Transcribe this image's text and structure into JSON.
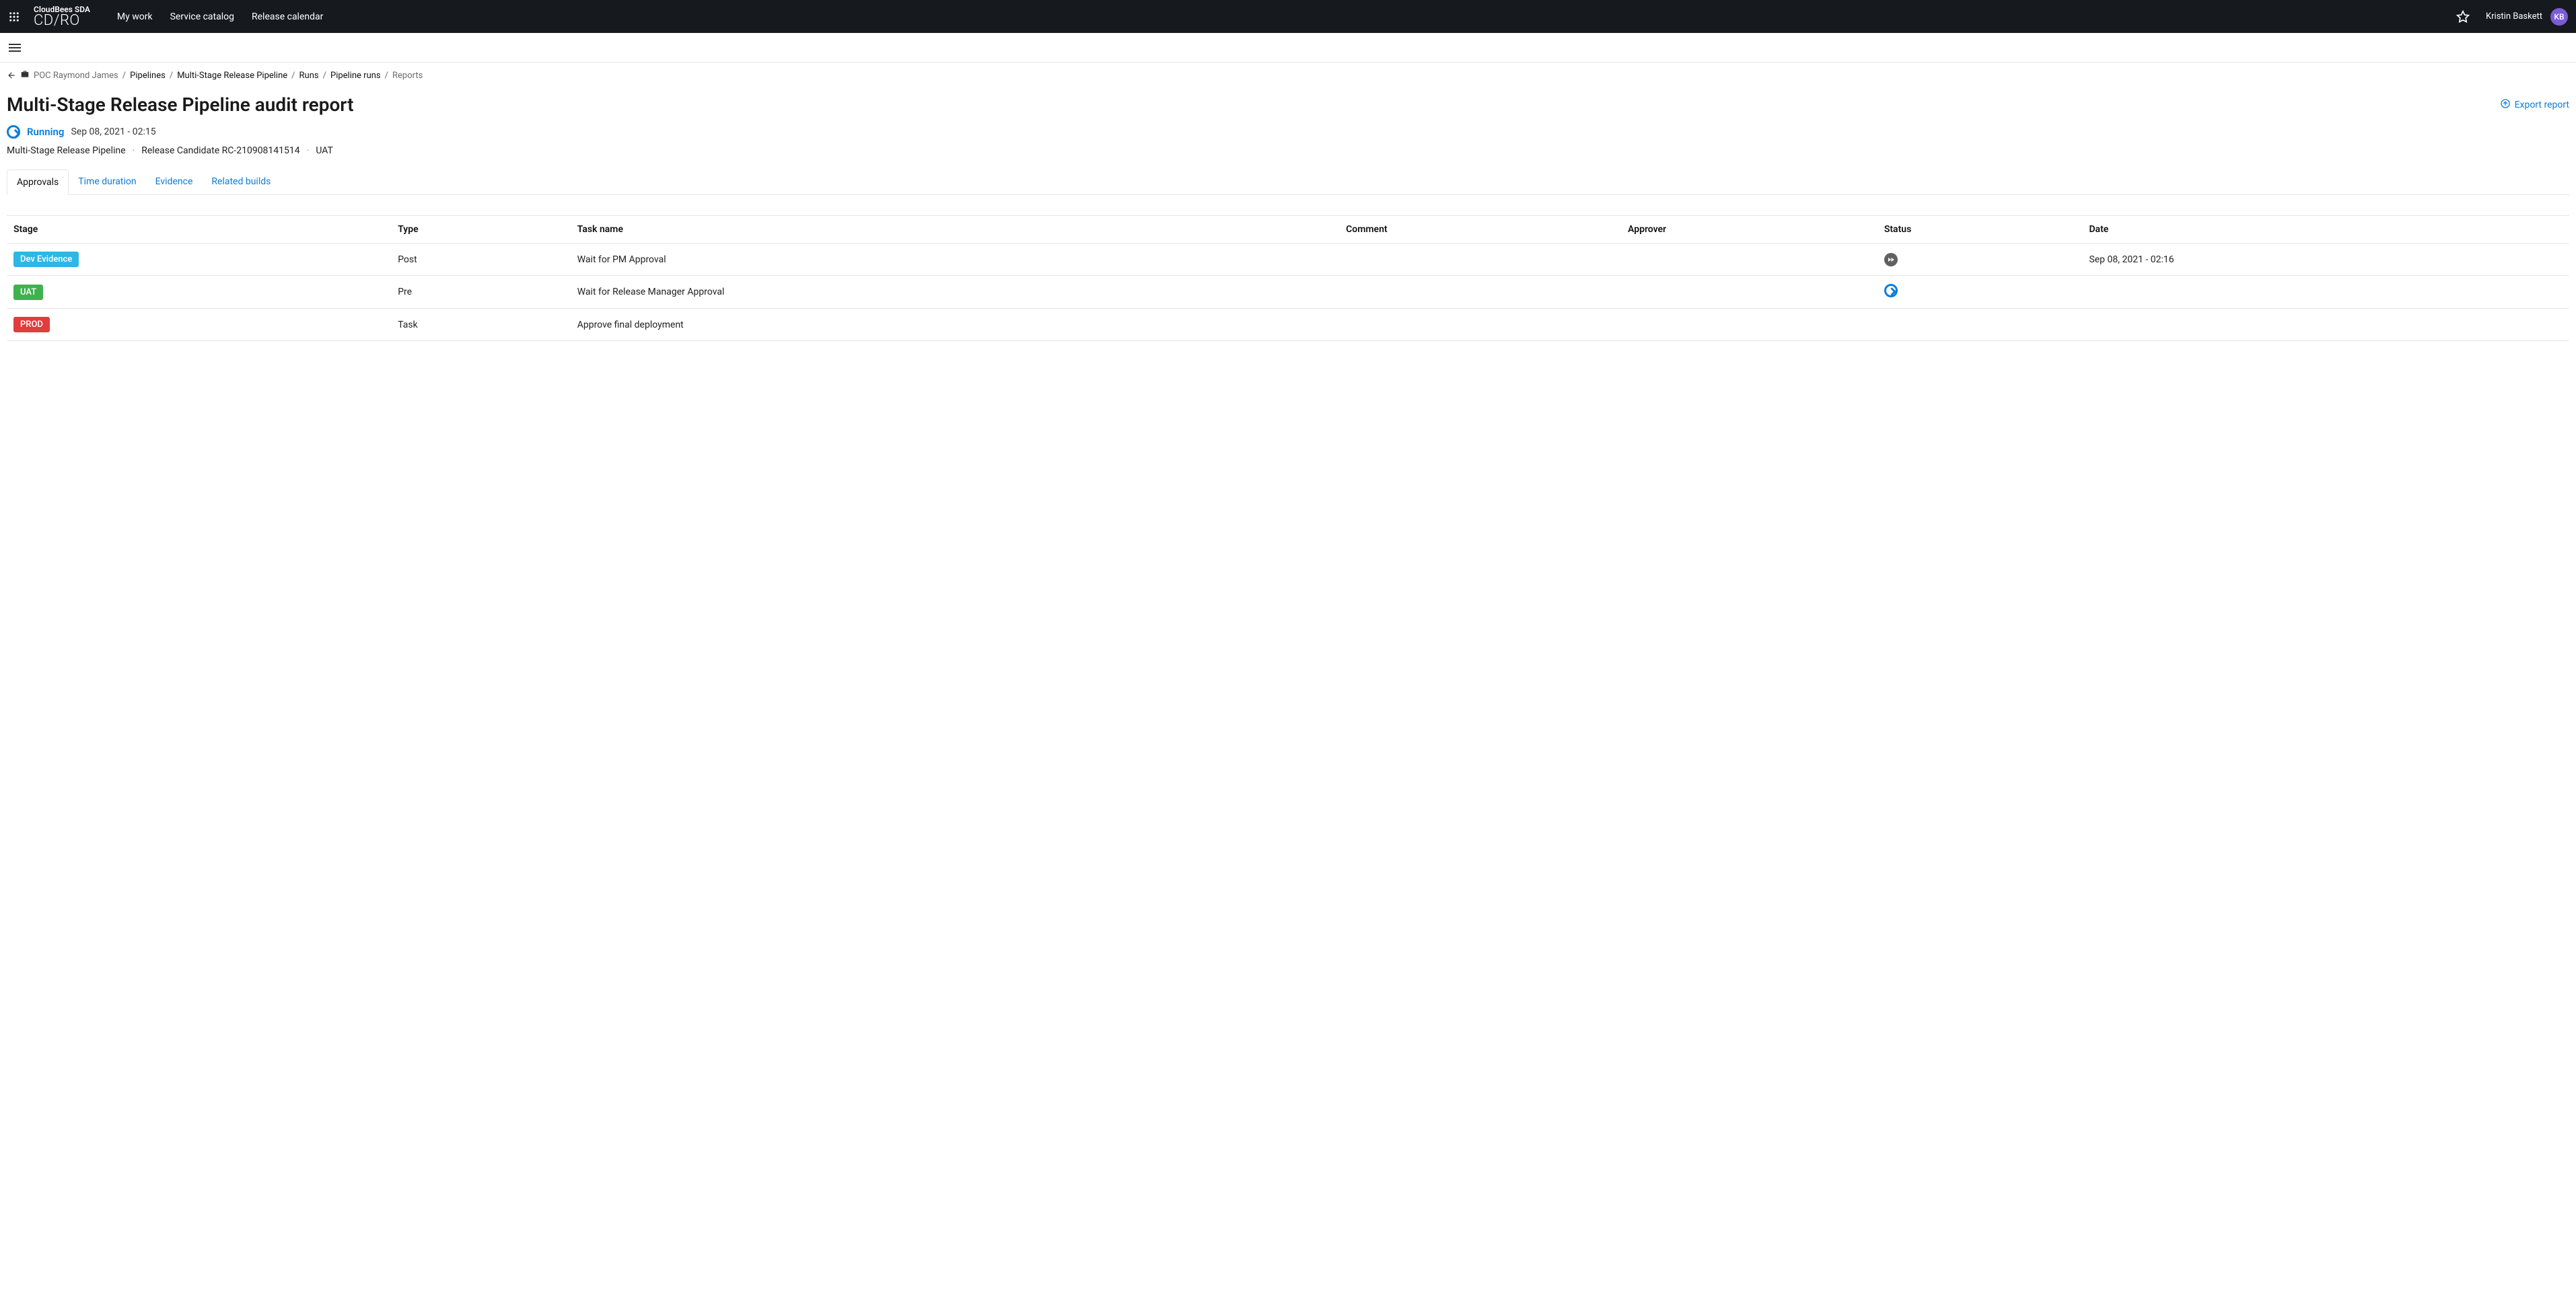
{
  "header": {
    "brand_top": "CloudBees SDA",
    "brand_bottom": "CD/RO",
    "nav": [
      "My work",
      "Service catalog",
      "Release calendar"
    ],
    "user_name": "Kristin Baskett",
    "user_initials": "KB"
  },
  "breadcrumbs": {
    "project": "POC Raymond James",
    "items": [
      "Pipelines",
      "Multi-Stage Release Pipeline",
      "Runs",
      "Pipeline runs"
    ],
    "current": "Reports"
  },
  "page": {
    "title": "Multi-Stage Release Pipeline audit report",
    "export_label": "Export report",
    "status_label": "Running",
    "status_date": "Sep 08, 2021 - 02:15",
    "subline": {
      "pipeline": "Multi-Stage Release Pipeline",
      "release": "Release Candidate RC-210908141514",
      "env": "UAT"
    }
  },
  "tabs": [
    "Approvals",
    "Time duration",
    "Evidence",
    "Related builds"
  ],
  "active_tab": "Approvals",
  "table": {
    "headers": [
      "Stage",
      "Type",
      "Task name",
      "Comment",
      "Approver",
      "Status",
      "Date"
    ],
    "rows": [
      {
        "stage": "Dev Evidence",
        "stage_color": "stage-cyan",
        "type": "Post",
        "task_name": "Wait for PM Approval",
        "comment": "",
        "approver": "",
        "status_kind": "skip",
        "date": "Sep 08, 2021 - 02:16"
      },
      {
        "stage": "UAT",
        "stage_color": "stage-green",
        "type": "Pre",
        "task_name": "Wait for Release Manager Approval",
        "comment": "",
        "approver": "",
        "status_kind": "running",
        "date": ""
      },
      {
        "stage": "PROD",
        "stage_color": "stage-red",
        "type": "Task",
        "task_name": "Approve final deployment",
        "comment": "",
        "approver": "",
        "status_kind": "",
        "date": ""
      }
    ]
  }
}
